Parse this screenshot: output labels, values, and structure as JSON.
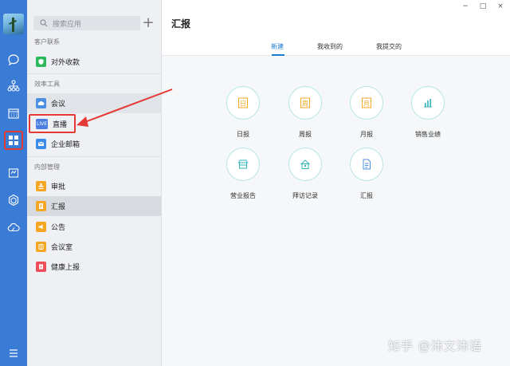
{
  "sidebar": {
    "search_placeholder": "搜索应用",
    "add_symbol": "+",
    "sections": [
      {
        "title": "客户联系",
        "items": [
          {
            "label": "对外收款",
            "icon": "payment-shield-icon",
            "color": "#2eb85c"
          }
        ]
      },
      {
        "title": "效率工具",
        "items": [
          {
            "label": "会议",
            "icon": "cloud-meeting-icon",
            "color": "#4a90e2"
          },
          {
            "label": "直播",
            "icon": "live-icon",
            "color": "#4a7fe0",
            "badge": "LIVE"
          },
          {
            "label": "企业邮箱",
            "icon": "mail-icon",
            "color": "#3d8be8"
          }
        ]
      },
      {
        "title": "内部管理",
        "items": [
          {
            "label": "审批",
            "icon": "approval-stamp-icon",
            "color": "#f5a623"
          },
          {
            "label": "汇报",
            "icon": "report-icon",
            "color": "#f5a623"
          },
          {
            "label": "公告",
            "icon": "announcement-icon",
            "color": "#f5a623"
          },
          {
            "label": "会议室",
            "icon": "meeting-room-icon",
            "color": "#f5a623"
          },
          {
            "label": "健康上报",
            "icon": "health-report-icon",
            "color": "#ef4d5a"
          }
        ]
      }
    ]
  },
  "main": {
    "title": "汇报",
    "tabs": [
      "新建",
      "我收到的",
      "我提交的"
    ],
    "active_tab": "新建",
    "grid": [
      {
        "label": "日报",
        "icon": "daily-report-icon",
        "char": "日",
        "color": "#f5a623"
      },
      {
        "label": "周报",
        "icon": "weekly-report-icon",
        "char": "周",
        "color": "#f5a623"
      },
      {
        "label": "月报",
        "icon": "monthly-report-icon",
        "char": "月",
        "color": "#f5a623"
      },
      {
        "label": "销售业绩",
        "icon": "sales-chart-icon",
        "color": "#2fb5b9"
      },
      {
        "label": "营业报告",
        "icon": "store-report-icon",
        "color": "#2fb5b9"
      },
      {
        "label": "拜访记录",
        "icon": "visit-record-icon",
        "color": "#2fb5b9"
      },
      {
        "label": "汇报",
        "icon": "report-doc-icon",
        "color": "#4a90e2"
      }
    ]
  },
  "window_controls": {
    "minimize": "−",
    "maximize": "□",
    "close": "×"
  },
  "watermark": "知乎 @沛文沛语",
  "colors": {
    "rail": "#3a7bd5",
    "accent": "#1d7bd8",
    "highlight": "#e53935"
  }
}
